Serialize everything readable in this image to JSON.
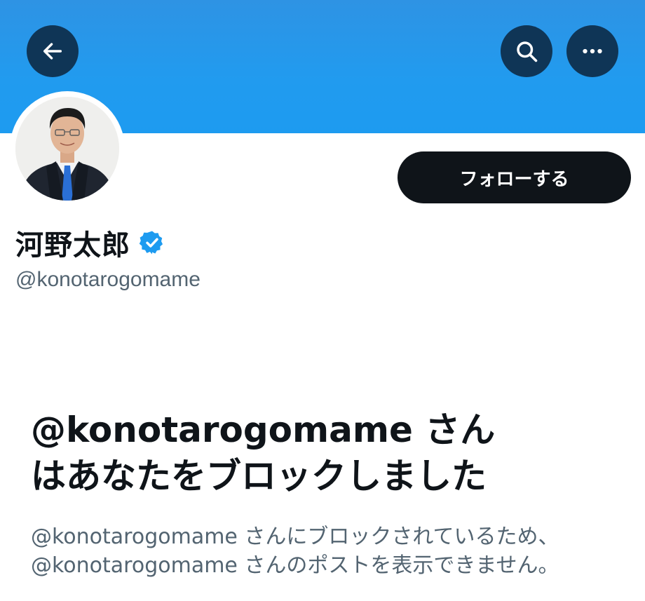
{
  "header": {
    "back_icon": "arrow-left-icon",
    "search_icon": "search-icon",
    "more_icon": "more-horizontal-icon",
    "banner_color": "#1d9bf0"
  },
  "profile": {
    "avatar_icon": "profile-photo",
    "display_name": "河野太郎",
    "verified_icon": "verified-badge-icon",
    "verified_color": "#1d9bf0",
    "handle": "@konotarogomame"
  },
  "actions": {
    "follow_label": "フォローする"
  },
  "blocked": {
    "title_line1": "@konotarogomame さん",
    "title_line2": "はあなたをブロックしました",
    "desc_line1": "@konotarogomame さんにブロックされているため、",
    "desc_line2": "@konotarogomame さんのポストを表示できません。"
  }
}
